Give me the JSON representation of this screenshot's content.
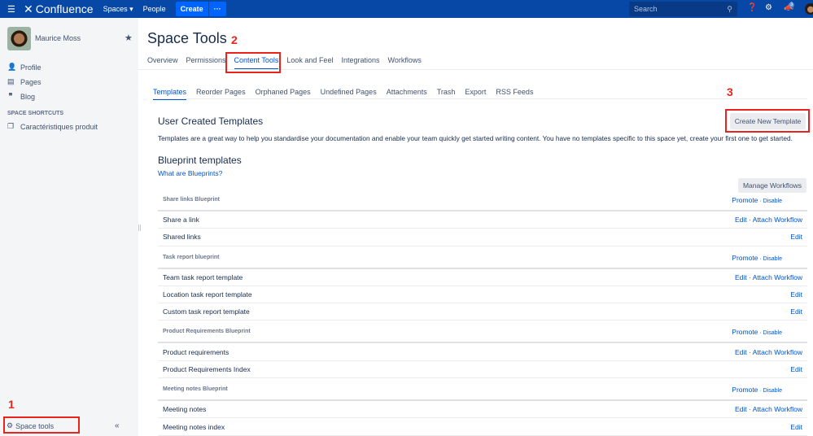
{
  "topbar": {
    "app": "Confluence",
    "spaces": "Spaces",
    "people": "People",
    "create": "Create",
    "more": "···",
    "search_placeholder": "Search",
    "notifications": "3"
  },
  "sidebar": {
    "user": "Maurice Moss",
    "items": [
      {
        "label": "Profile",
        "icon": "person-icon"
      },
      {
        "label": "Pages",
        "icon": "pages-icon"
      },
      {
        "label": "Blog",
        "icon": "quote-icon"
      }
    ],
    "shortcuts_header": "SPACE SHORTCUTS",
    "shortcuts": [
      "Caractéristiques produit"
    ],
    "space_tools": "Space tools",
    "collapse": "«"
  },
  "annotations": [
    "1",
    "2",
    "3"
  ],
  "page": {
    "title": "Space Tools",
    "tabs": [
      "Overview",
      "Permissions",
      "Content Tools",
      "Look and Feel",
      "Integrations",
      "Workflows"
    ],
    "subtabs": [
      "Templates",
      "Reorder Pages",
      "Orphaned Pages",
      "Undefined Pages",
      "Attachments",
      "Trash",
      "Export",
      "RSS Feeds"
    ],
    "user_templates_title": "User Created Templates",
    "create_button": "Create New Template",
    "description": "Templates are a great way to help you standardise your documentation and enable your team quickly get started writing content. You have no templates specific to this space yet, create your first one to get started.",
    "blueprint_title": "Blueprint templates",
    "blueprint_link": "What are Blueprints?",
    "manage_workflows": "Manage Workflows",
    "promote": "Promote",
    "disable": "Disable",
    "sep": " · ",
    "edit": "Edit",
    "attach": "Attach Workflow",
    "groups": [
      {
        "name": "Share links Blueprint",
        "rows": [
          {
            "name": "Share a link",
            "workflow": true
          },
          {
            "name": "Shared links",
            "workflow": false
          }
        ]
      },
      {
        "name": "Task report blueprint",
        "rows": [
          {
            "name": "Team task report template",
            "workflow": true
          },
          {
            "name": "Location task report template",
            "workflow": false
          },
          {
            "name": "Custom task report template",
            "workflow": false
          }
        ]
      },
      {
        "name": "Product Requirements Blueprint",
        "rows": [
          {
            "name": "Product requirements",
            "workflow": true
          },
          {
            "name": "Product Requirements Index",
            "workflow": false
          }
        ]
      },
      {
        "name": "Meeting notes Blueprint",
        "rows": [
          {
            "name": "Meeting notes",
            "workflow": true
          },
          {
            "name": "Meeting notes index",
            "workflow": false
          }
        ]
      }
    ]
  }
}
